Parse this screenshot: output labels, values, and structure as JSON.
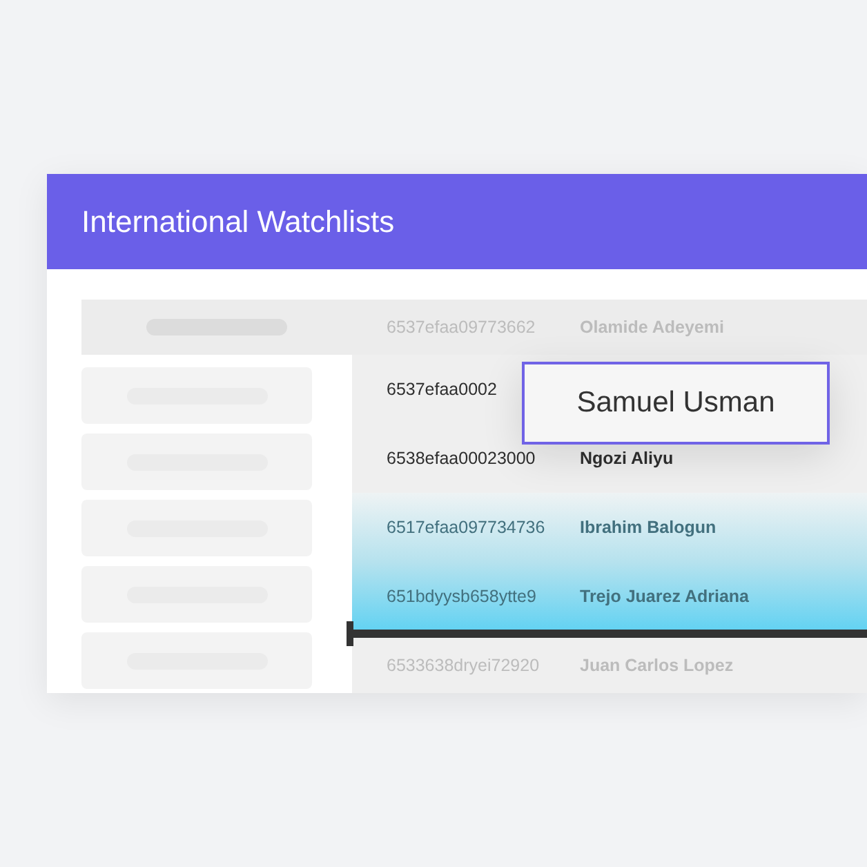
{
  "window": {
    "title": "International Watchlists"
  },
  "table": {
    "rows": [
      {
        "id": "6537efaa09773662",
        "name": "Olamide Adeyemi",
        "kind": "faded"
      },
      {
        "id": "6537efaa0002",
        "kind": "normal"
      },
      {
        "id": "6538efaa00023000",
        "name": "Ngozi Aliyu",
        "kind": "normal"
      },
      {
        "id": "6517efaa097734736",
        "name": "Ibrahim Balogun",
        "kind": "highlighted"
      },
      {
        "id": "651bdyysb658ytte9",
        "name": "Trejo Juarez Adriana",
        "kind": "highlighted"
      },
      {
        "id": "6533638dryei72920",
        "name": "Juan Carlos Lopez",
        "kind": "faded"
      }
    ]
  },
  "tooltip": {
    "text": "Samuel Usman"
  }
}
